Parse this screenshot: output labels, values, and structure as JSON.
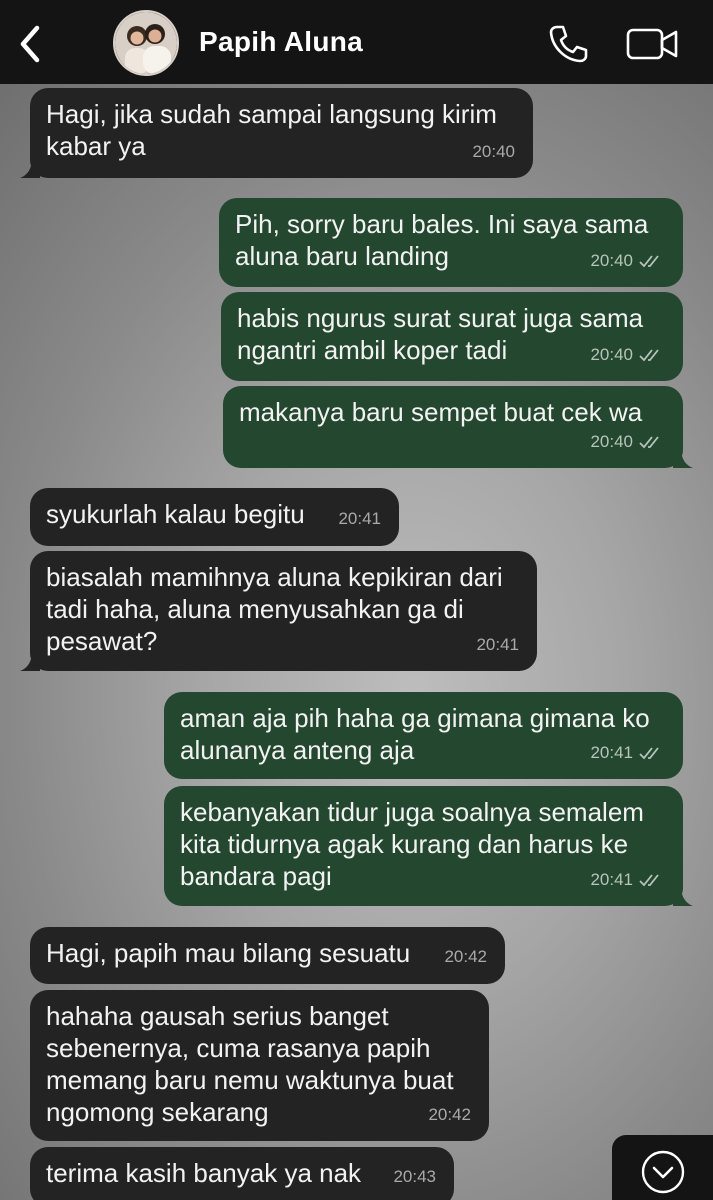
{
  "header": {
    "contact_name": "Papih Aluna",
    "icons": [
      "back-chevron-icon",
      "avatar",
      "phone-icon",
      "video-camera-icon"
    ]
  },
  "colors": {
    "header_bg": "#141414",
    "incoming_bubble": "#232323",
    "outgoing_bubble": "#24472f",
    "text": "#f2f2f2",
    "timestamp": "#a9a9a9"
  },
  "messages": [
    {
      "dir": "in",
      "text": "Hagi, jika sudah sampai langsung kirim\nkabar ya",
      "time": "20:40"
    },
    {
      "dir": "out",
      "text": "Pih, sorry baru bales. Ini saya sama\naluna baru landing",
      "time": "20:40",
      "status": "read"
    },
    {
      "dir": "out",
      "text": "habis ngurus surat surat juga sama\nngantri ambil koper tadi",
      "time": "20:40",
      "status": "read"
    },
    {
      "dir": "out",
      "text": "makanya baru sempet buat cek wa",
      "time": "20:40",
      "status": "read"
    },
    {
      "dir": "in",
      "text": "syukurlah kalau begitu",
      "time": "20:41"
    },
    {
      "dir": "in",
      "text": "biasalah mamihnya aluna kepikiran dari\ntadi haha, aluna menyusahkan ga di\npesawat?",
      "time": "20:41"
    },
    {
      "dir": "out",
      "text": "aman aja pih haha ga gimana gimana ko\nalunanya anteng aja",
      "time": "20:41",
      "status": "read"
    },
    {
      "dir": "out",
      "text": "kebanyakan tidur juga soalnya semalem\nkita tidurnya agak kurang dan harus ke\nbandara pagi",
      "time": "20:41",
      "status": "read"
    },
    {
      "dir": "in",
      "text": "Hagi, papih mau bilang sesuatu",
      "time": "20:42"
    },
    {
      "dir": "in",
      "text": "hahaha gausah serius banget\nsebenernya, cuma rasanya papih\nmemang baru nemu waktunya buat\nngomong sekarang",
      "time": "20:42"
    },
    {
      "dir": "in",
      "text": "terima kasih banyak ya nak",
      "time": "20:43"
    }
  ]
}
